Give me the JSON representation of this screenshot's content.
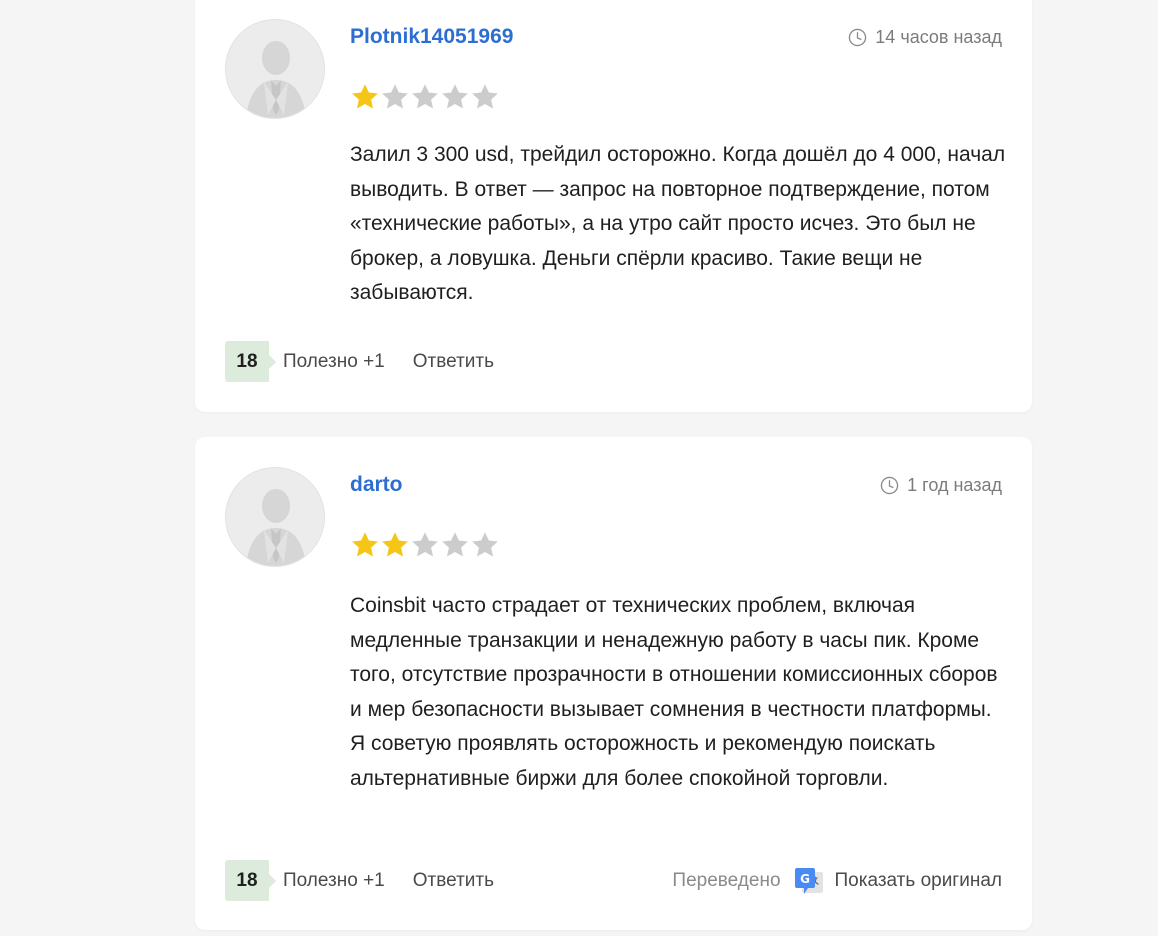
{
  "reviews": [
    {
      "author": "Plotnik14051969",
      "time": "14 часов назад",
      "rating": 1,
      "max_rating": 5,
      "text": "Залил 3 300 usd, трейдил осторожно. Когда дошёл до 4 000, начал выводить. В ответ — запрос на повторное подтверждение, потом «технические работы», а на утро сайт просто исчез. Это был не брокер, а ловушка. Деньги спёрли красиво. Такие вещи не забываются.",
      "helpful_count": "18",
      "helpful_label": "Полезно +1",
      "reply_label": "Ответить"
    },
    {
      "author": "darto",
      "time": "1 год назад",
      "rating": 2,
      "max_rating": 5,
      "text": "Coinsbit часто страдает от технических проблем, включая медленные транзакции и ненадежную работу в часы пик. Кроме того, отсутствие прозрачности в отношении комиссионных сборов и мер безопасности вызывает сомнения в честности платформы. Я советую проявлять осторожность и рекомендую поискать альтернативные биржи для более спокойной торговли.",
      "helpful_count": "18",
      "helpful_label": "Полезно +1",
      "reply_label": "Ответить",
      "translated_label": "Переведено",
      "translate_icon": "google-translate-icon",
      "show_original_label": "Показать оригинал"
    }
  ],
  "colors": {
    "author_link": "#2d6fd0",
    "star_filled": "#f5c518",
    "star_empty": "#cccccc",
    "badge_bg": "#dcebdc",
    "page_bg": "#f5f5f5"
  },
  "icons": {
    "avatar": "user-silhouette-icon",
    "time": "clock-icon",
    "rating": "star-icon"
  }
}
